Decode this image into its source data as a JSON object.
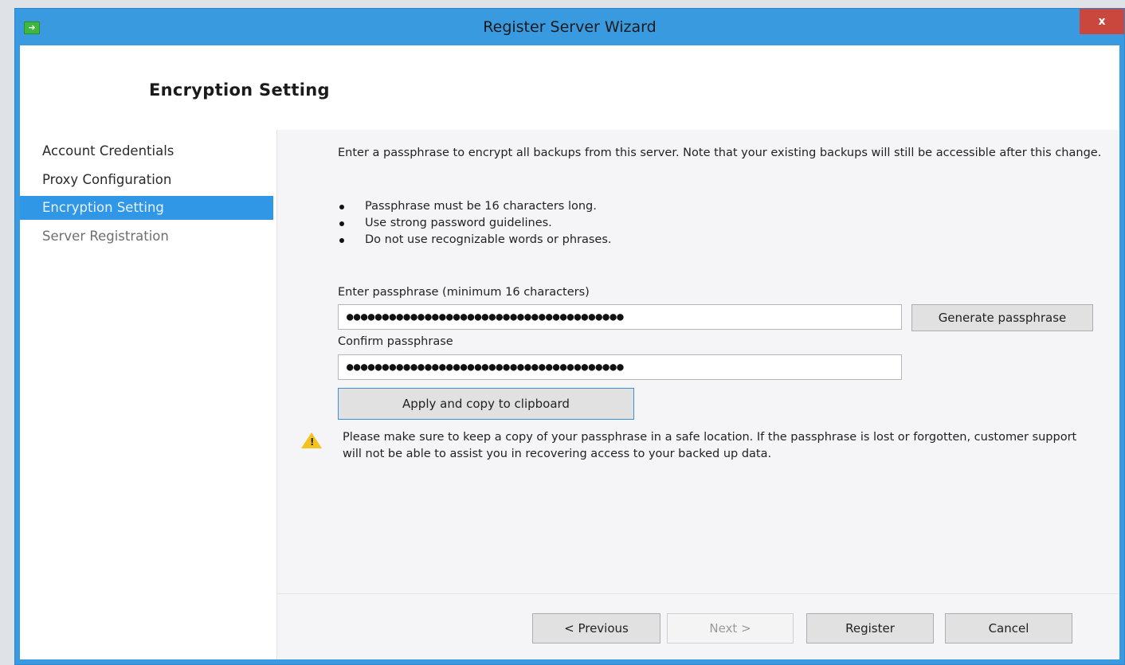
{
  "window": {
    "title": "Register Server Wizard",
    "close_label": "x",
    "icon": "arrow-right-icon"
  },
  "header": {
    "title": "Encryption Setting"
  },
  "nav": {
    "items": [
      {
        "label": "Account Credentials",
        "state": "done"
      },
      {
        "label": "Proxy Configuration",
        "state": "done"
      },
      {
        "label": "Encryption Setting",
        "state": "active"
      },
      {
        "label": "Server Registration",
        "state": "pending"
      }
    ]
  },
  "main": {
    "intro": "Enter a passphrase to encrypt all backups from this server. Note that your existing backups will still be accessible after this change.",
    "bullets": [
      "Passphrase must be 16 characters long.",
      "Use strong password guidelines.",
      "Do not use recognizable words or phrases."
    ],
    "passphrase_label": "Enter passphrase (minimum 16 characters)",
    "passphrase_value": "●●●●●●●●●●●●●●●●●●●●●●●●●●●●●●●●●●●●●●●",
    "generate_label": "Generate passphrase",
    "confirm_label": "Confirm passphrase",
    "confirm_value": "●●●●●●●●●●●●●●●●●●●●●●●●●●●●●●●●●●●●●●●",
    "apply_label": "Apply and copy to clipboard",
    "warning_text": "Please make sure to keep a copy of your passphrase in a safe location. If the passphrase is lost or forgotten, customer support will not be able to assist you in recovering access to your backed up data.",
    "warning_icon": "warning-triangle-icon"
  },
  "footer": {
    "previous_label": "< Previous",
    "next_label": "Next >",
    "register_label": "Register",
    "cancel_label": "Cancel"
  },
  "colors": {
    "titlebar": "#3a9ae0",
    "nav_active": "#2f97e6",
    "close": "#c9473d",
    "warning": "#f4c21a"
  }
}
